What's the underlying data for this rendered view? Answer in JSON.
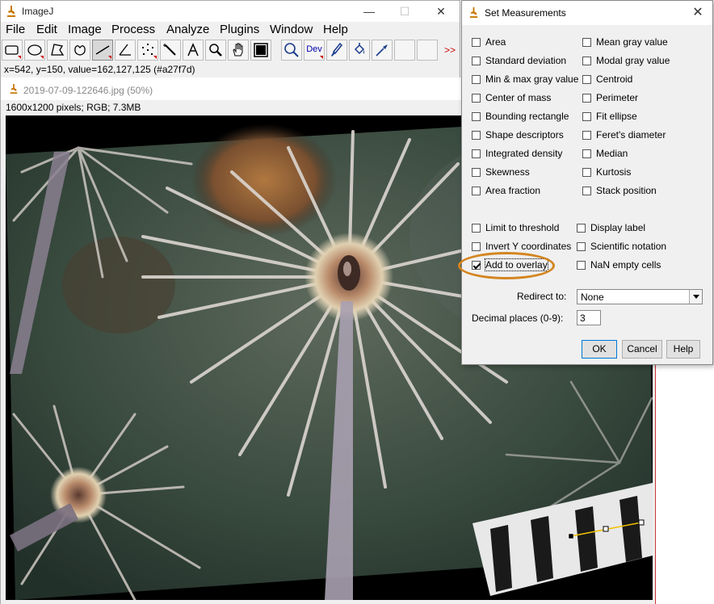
{
  "ij_window": {
    "title": "ImageJ",
    "menus": [
      "File",
      "Edit",
      "Image",
      "Process",
      "Analyze",
      "Plugins",
      "Window",
      "Help"
    ],
    "dev_tool_label": "Dev",
    "more_tools_label": ">>",
    "status": "x=542, y=150, value=162,127,125 (#a27f7d)"
  },
  "image_window": {
    "title": "2019-07-09-122646.jpg (50%)",
    "info": "1600x1200 pixels; RGB; 7.3MB"
  },
  "dialog": {
    "title": "Set Measurements",
    "left_options": [
      {
        "label": "Area",
        "checked": false
      },
      {
        "label": "Standard deviation",
        "checked": false
      },
      {
        "label": "Min & max gray value",
        "checked": false
      },
      {
        "label": "Center of mass",
        "checked": false
      },
      {
        "label": "Bounding rectangle",
        "checked": false
      },
      {
        "label": "Shape descriptors",
        "checked": false
      },
      {
        "label": "Integrated density",
        "checked": false
      },
      {
        "label": "Skewness",
        "checked": false
      },
      {
        "label": "Area fraction",
        "checked": false
      }
    ],
    "right_options": [
      {
        "label": "Mean gray value",
        "checked": false
      },
      {
        "label": "Modal gray value",
        "checked": false
      },
      {
        "label": "Centroid",
        "checked": false
      },
      {
        "label": "Perimeter",
        "checked": false
      },
      {
        "label": "Fit ellipse",
        "checked": false
      },
      {
        "label": "Feret's diameter",
        "checked": false
      },
      {
        "label": "Median",
        "checked": false
      },
      {
        "label": "Kurtosis",
        "checked": false
      },
      {
        "label": "Stack position",
        "checked": false
      }
    ],
    "extra_left": [
      {
        "label": "Limit to threshold",
        "checked": false
      },
      {
        "label": "Invert Y coordinates",
        "checked": false
      },
      {
        "label": "Add to overlay",
        "checked": true
      }
    ],
    "extra_right": [
      {
        "label": "Display label",
        "checked": false
      },
      {
        "label": "Scientific notation",
        "checked": false
      },
      {
        "label": "NaN empty cells",
        "checked": false
      }
    ],
    "redirect_label": "Redirect to:",
    "redirect_value": "None",
    "decimal_label": "Decimal places (0-9):",
    "decimal_value": "3",
    "buttons": {
      "ok": "OK",
      "cancel": "Cancel",
      "help": "Help"
    }
  },
  "colors": {
    "highlight": "#d4851e",
    "line_selection": "#f0c000"
  }
}
